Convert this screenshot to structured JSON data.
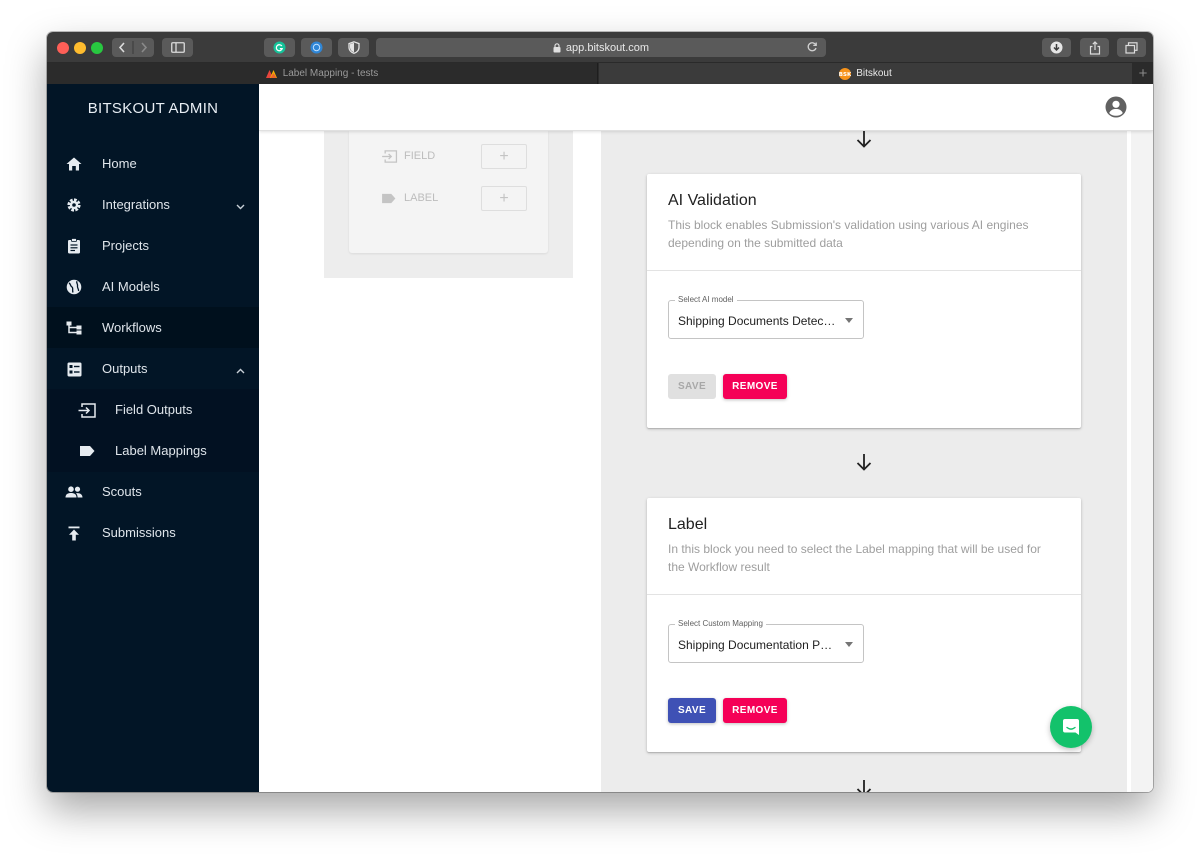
{
  "browser": {
    "url": "app.bitskout.com",
    "tabs": [
      {
        "title": "Label Mapping - tests",
        "active": false
      },
      {
        "title": "Bitskout",
        "active": true
      }
    ],
    "new_tab_symbol": "+"
  },
  "sidebar": {
    "brand": "BITSKOUT ADMIN",
    "items": [
      {
        "label": "Home",
        "icon": "home-icon"
      },
      {
        "label": "Integrations",
        "icon": "gear-icon",
        "expandable": true,
        "expanded": false
      },
      {
        "label": "Projects",
        "icon": "clipboard-icon"
      },
      {
        "label": "AI Models",
        "icon": "globe-icon"
      },
      {
        "label": "Workflows",
        "icon": "workflow-icon",
        "active": true
      },
      {
        "label": "Outputs",
        "icon": "list-icon",
        "expandable": true,
        "expanded": true
      },
      {
        "label": "Field Outputs",
        "icon": "input-icon",
        "sub": true
      },
      {
        "label": "Label Mappings",
        "icon": "label-icon",
        "sub": true
      },
      {
        "label": "Scouts",
        "icon": "people-icon"
      },
      {
        "label": "Submissions",
        "icon": "upload-icon"
      }
    ]
  },
  "palette": {
    "field_label": "FIELD",
    "label_label": "LABEL",
    "add_symbol": "+"
  },
  "blocks": [
    {
      "title": "AI Validation",
      "description": "This block enables Submission's validation using various AI engines depending on the submitted data",
      "select_label": "Select AI model",
      "select_value": "Shipping Documents Detection",
      "save_label": "SAVE",
      "save_enabled": false,
      "remove_label": "REMOVE"
    },
    {
      "title": "Label",
      "description": "In this block you need to select the Label mapping that will be used for the Workflow result",
      "select_label": "Select Custom Mapping",
      "select_value": "Shipping Documentation PDFs",
      "save_label": "SAVE",
      "save_enabled": true,
      "remove_label": "REMOVE"
    }
  ],
  "colors": {
    "sidebar_bg": "#021526",
    "primary": "#3f51b5",
    "danger": "#f50057",
    "chat": "#13c26b"
  }
}
